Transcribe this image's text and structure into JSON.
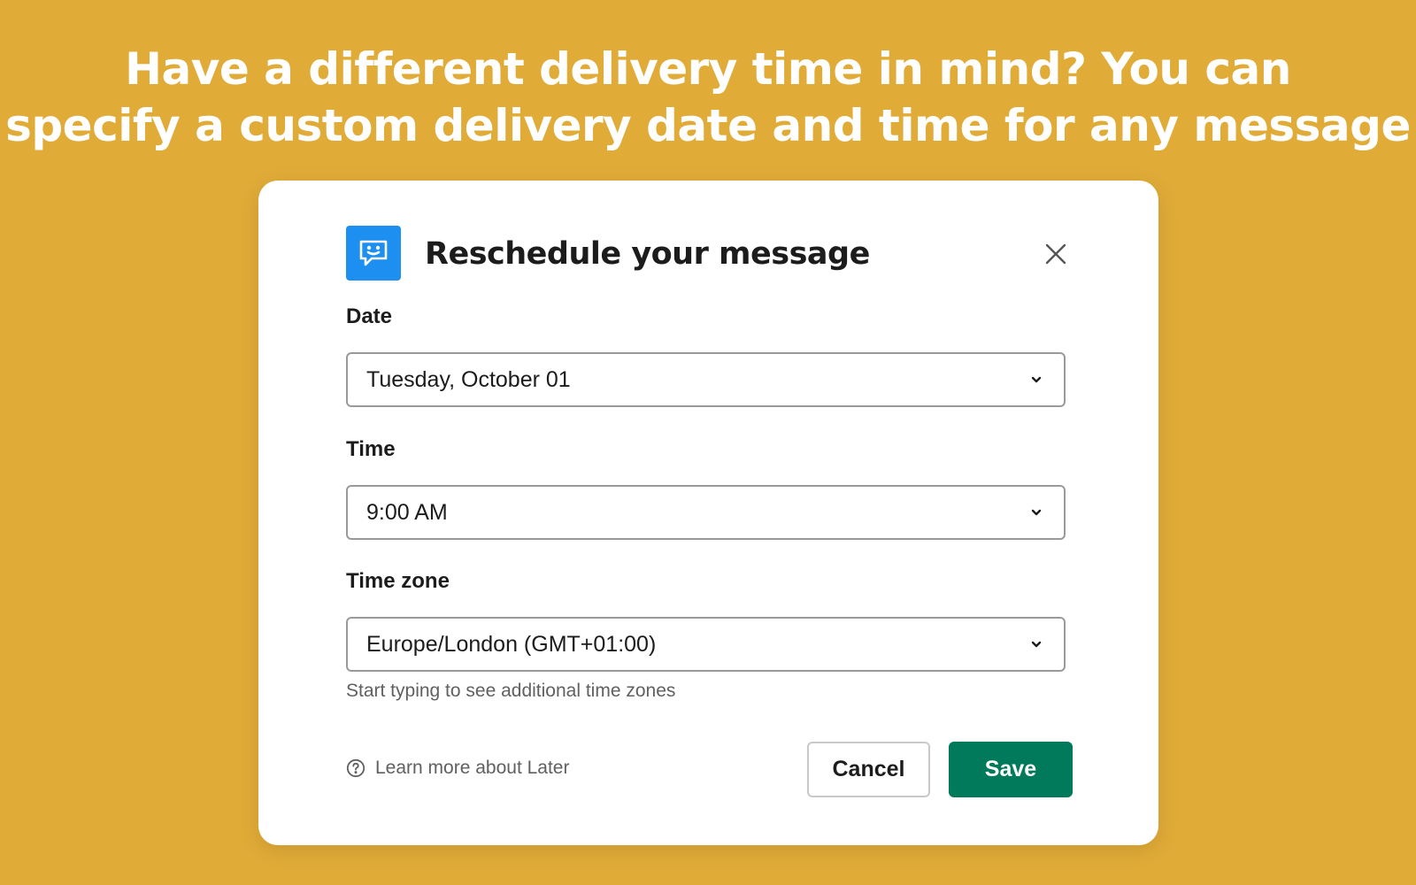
{
  "headline": {
    "line1": "Have a different delivery time in mind? You can",
    "line2": "specify a custom delivery date and time for any message"
  },
  "dialog": {
    "icon": "message-bubble-icon",
    "title": "Reschedule your message",
    "close_icon": "close-icon",
    "fields": {
      "date": {
        "label": "Date",
        "value": "Tuesday, October 01"
      },
      "time": {
        "label": "Time",
        "value": "9:00 AM"
      },
      "timezone": {
        "label": "Time zone",
        "value": "Europe/London (GMT+01:00)",
        "hint": "Start typing to see additional time zones"
      }
    },
    "learn_more": {
      "icon": "question-circle-icon",
      "label": "Learn more about Later"
    },
    "buttons": {
      "cancel": "Cancel",
      "save": "Save"
    }
  },
  "colors": {
    "background": "#e0ab37",
    "icon_blue": "#1d8ff0",
    "save_green": "#007a5a"
  }
}
